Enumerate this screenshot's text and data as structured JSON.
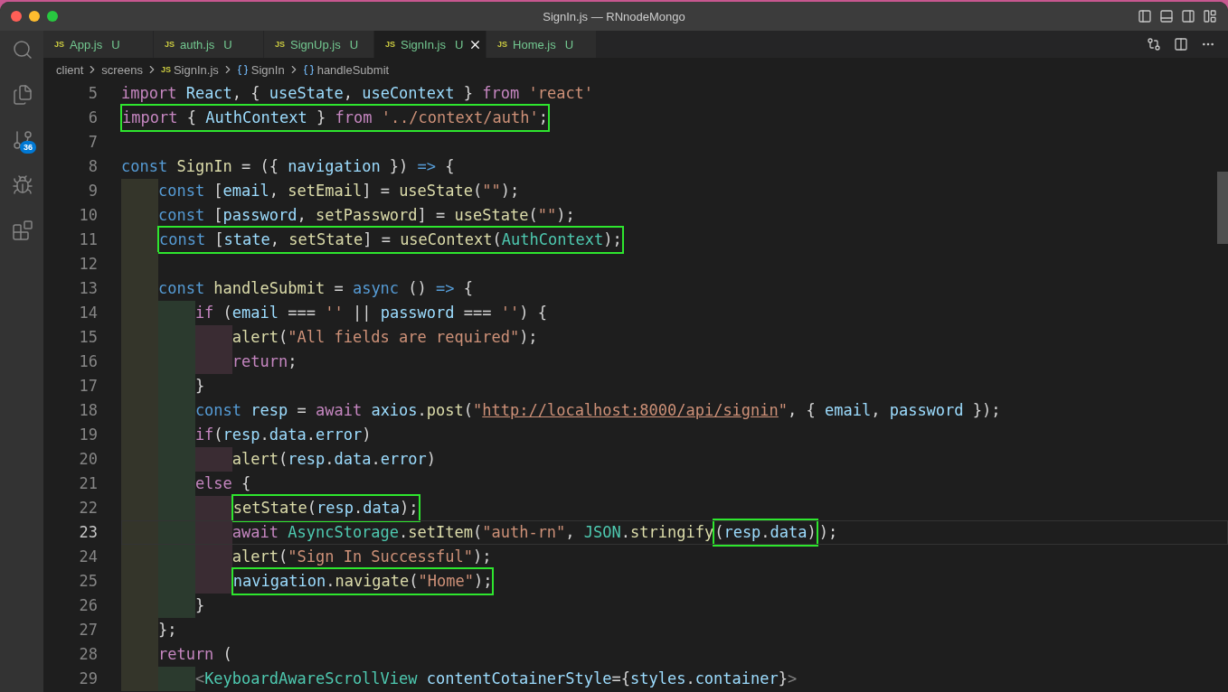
{
  "window": {
    "title": "SignIn.js — RNnodeMongo"
  },
  "activity_bar": [
    {
      "kind": "search",
      "selected": false
    },
    {
      "kind": "explorer",
      "selected": false
    },
    {
      "kind": "source-control",
      "selected": false,
      "badge": "36"
    },
    {
      "kind": "debug",
      "selected": false
    },
    {
      "kind": "extensions",
      "selected": false
    }
  ],
  "tabs": [
    {
      "icon_text": "JS",
      "label": "App.js",
      "status": "U",
      "selected": false
    },
    {
      "icon_text": "JS",
      "label": "auth.js",
      "status": "U",
      "selected": false
    },
    {
      "icon_text": "JS",
      "label": "SignUp.js",
      "status": "U",
      "selected": false
    },
    {
      "icon_text": "JS",
      "label": "SignIn.js",
      "status": "U",
      "selected": true
    },
    {
      "icon_text": "JS",
      "label": "Home.js",
      "status": "U",
      "selected": false
    }
  ],
  "breadcrumb": [
    {
      "kind": "folder",
      "label": "client"
    },
    {
      "kind": "folder",
      "label": "screens"
    },
    {
      "kind": "file",
      "icon_text": "JS",
      "label": "SignIn.js"
    },
    {
      "kind": "symbol",
      "label": "SignIn"
    },
    {
      "kind": "symbol",
      "label": "handleSubmit"
    }
  ],
  "editor": {
    "lines": [
      {
        "number": "5",
        "current": false,
        "parts": [
          {
            "kind": "kw",
            "text": "import "
          },
          {
            "kind": "var",
            "text": "React"
          },
          {
            "kind": "p",
            "text": ", { "
          },
          {
            "kind": "var",
            "text": "useState"
          },
          {
            "kind": "p",
            "text": ", "
          },
          {
            "kind": "var",
            "text": "useContext"
          },
          {
            "kind": "p",
            "text": " } "
          },
          {
            "kind": "kw",
            "text": "from "
          },
          {
            "kind": "str",
            "text": "'react'"
          }
        ]
      },
      {
        "number": "6",
        "current": false,
        "parts": [
          {
            "kind": "box",
            "parts": [
              {
                "kind": "kw",
                "text": "import "
              },
              {
                "kind": "p",
                "text": "{ "
              },
              {
                "kind": "var",
                "text": "AuthContext"
              },
              {
                "kind": "p",
                "text": " } "
              },
              {
                "kind": "kw",
                "text": "from "
              },
              {
                "kind": "str",
                "text": "'../context/auth'"
              },
              {
                "kind": "p",
                "text": ";"
              }
            ]
          }
        ]
      },
      {
        "number": "7",
        "current": false
      },
      {
        "number": "8",
        "current": false,
        "parts": [
          {
            "kind": "st",
            "text": "const "
          },
          {
            "kind": "fn",
            "text": "SignIn"
          },
          {
            "kind": "p",
            "text": " = ({ "
          },
          {
            "kind": "var",
            "text": "navigation"
          },
          {
            "kind": "p",
            "text": " }) "
          },
          {
            "kind": "st",
            "text": "=>"
          },
          {
            "kind": "p",
            "text": " {"
          }
        ]
      },
      {
        "number": "9",
        "current": false,
        "guides": [
          {
            "color": "#34352a"
          }
        ],
        "parts": [
          {
            "kind": "st",
            "text": "const "
          },
          {
            "kind": "p",
            "text": "["
          },
          {
            "kind": "var",
            "text": "email"
          },
          {
            "kind": "p",
            "text": ", "
          },
          {
            "kind": "fn",
            "text": "setEmail"
          },
          {
            "kind": "p",
            "text": "] = "
          },
          {
            "kind": "fn",
            "text": "useState"
          },
          {
            "kind": "p",
            "text": "("
          },
          {
            "kind": "str",
            "text": "\"\""
          },
          {
            "kind": "p",
            "text": ");"
          }
        ]
      },
      {
        "number": "10",
        "current": false,
        "guides": [
          {
            "color": "#34352a"
          }
        ],
        "parts": [
          {
            "kind": "st",
            "text": "const "
          },
          {
            "kind": "p",
            "text": "["
          },
          {
            "kind": "var",
            "text": "password"
          },
          {
            "kind": "p",
            "text": ", "
          },
          {
            "kind": "fn",
            "text": "setPassword"
          },
          {
            "kind": "p",
            "text": "] = "
          },
          {
            "kind": "fn",
            "text": "useState"
          },
          {
            "kind": "p",
            "text": "("
          },
          {
            "kind": "str",
            "text": "\"\""
          },
          {
            "kind": "p",
            "text": ");"
          }
        ]
      },
      {
        "number": "11",
        "current": false,
        "guides": [
          {
            "color": "#34352a"
          }
        ],
        "parts": [
          {
            "kind": "box",
            "parts": [
              {
                "kind": "st",
                "text": "const "
              },
              {
                "kind": "p",
                "text": "["
              },
              {
                "kind": "var",
                "text": "state"
              },
              {
                "kind": "p",
                "text": ", "
              },
              {
                "kind": "fn",
                "text": "setState"
              },
              {
                "kind": "p",
                "text": "] = "
              },
              {
                "kind": "fn",
                "text": "useContext"
              },
              {
                "kind": "p",
                "text": "("
              },
              {
                "kind": "cls",
                "text": "AuthContext"
              },
              {
                "kind": "p",
                "text": ");"
              }
            ]
          }
        ]
      },
      {
        "number": "12",
        "current": false,
        "guides": [
          {
            "color": "#34352a"
          }
        ]
      },
      {
        "number": "13",
        "current": false,
        "guides": [
          {
            "color": "#34352a"
          }
        ],
        "parts": [
          {
            "kind": "st",
            "text": "const "
          },
          {
            "kind": "fn",
            "text": "handleSubmit"
          },
          {
            "kind": "p",
            "text": " = "
          },
          {
            "kind": "st",
            "text": "async"
          },
          {
            "kind": "p",
            "text": " () "
          },
          {
            "kind": "st",
            "text": "=>"
          },
          {
            "kind": "p",
            "text": " {"
          }
        ]
      },
      {
        "number": "14",
        "current": false,
        "guides": [
          {
            "color": "#34352a"
          },
          {
            "color": "#2b3a2e"
          }
        ],
        "parts": [
          {
            "kind": "kw",
            "text": "if"
          },
          {
            "kind": "p",
            "text": " ("
          },
          {
            "kind": "var",
            "text": "email"
          },
          {
            "kind": "p",
            "text": " === "
          },
          {
            "kind": "str",
            "text": "''"
          },
          {
            "kind": "p",
            "text": " || "
          },
          {
            "kind": "var",
            "text": "password"
          },
          {
            "kind": "p",
            "text": " === "
          },
          {
            "kind": "str",
            "text": "''"
          },
          {
            "kind": "p",
            "text": ") {"
          }
        ]
      },
      {
        "number": "15",
        "current": false,
        "guides": [
          {
            "color": "#34352a"
          },
          {
            "color": "#2b3a2e"
          },
          {
            "color": "#3a2c33"
          }
        ],
        "parts": [
          {
            "kind": "fn",
            "text": "alert"
          },
          {
            "kind": "p",
            "text": "("
          },
          {
            "kind": "str",
            "text": "\"All fields are required\""
          },
          {
            "kind": "p",
            "text": ");"
          }
        ]
      },
      {
        "number": "16",
        "current": false,
        "guides": [
          {
            "color": "#34352a"
          },
          {
            "color": "#2b3a2e"
          },
          {
            "color": "#3a2c33"
          }
        ],
        "parts": [
          {
            "kind": "kw",
            "text": "return"
          },
          {
            "kind": "p",
            "text": ";"
          }
        ]
      },
      {
        "number": "17",
        "current": false,
        "guides": [
          {
            "color": "#34352a"
          },
          {
            "color": "#2b3a2e"
          }
        ],
        "parts": [
          {
            "kind": "p",
            "text": "}"
          }
        ]
      },
      {
        "number": "18",
        "current": false,
        "guides": [
          {
            "color": "#34352a"
          },
          {
            "color": "#2b3a2e"
          }
        ],
        "parts": [
          {
            "kind": "st",
            "text": "const "
          },
          {
            "kind": "var",
            "text": "resp"
          },
          {
            "kind": "p",
            "text": " = "
          },
          {
            "kind": "kw",
            "text": "await "
          },
          {
            "kind": "var",
            "text": "axios"
          },
          {
            "kind": "p",
            "text": "."
          },
          {
            "kind": "fn",
            "text": "post"
          },
          {
            "kind": "p",
            "text": "("
          },
          {
            "kind": "str",
            "text": "\""
          },
          {
            "kind": "link",
            "text": "http://localhost:8000/api/signin"
          },
          {
            "kind": "str",
            "text": "\""
          },
          {
            "kind": "p",
            "text": ", { "
          },
          {
            "kind": "var",
            "text": "email"
          },
          {
            "kind": "p",
            "text": ", "
          },
          {
            "kind": "var",
            "text": "password"
          },
          {
            "kind": "p",
            "text": " });"
          }
        ]
      },
      {
        "number": "19",
        "current": false,
        "guides": [
          {
            "color": "#34352a"
          },
          {
            "color": "#2b3a2e"
          }
        ],
        "parts": [
          {
            "kind": "kw",
            "text": "if"
          },
          {
            "kind": "p",
            "text": "("
          },
          {
            "kind": "var",
            "text": "resp"
          },
          {
            "kind": "p",
            "text": "."
          },
          {
            "kind": "var",
            "text": "data"
          },
          {
            "kind": "p",
            "text": "."
          },
          {
            "kind": "var",
            "text": "error"
          },
          {
            "kind": "p",
            "text": ")"
          }
        ]
      },
      {
        "number": "20",
        "current": false,
        "guides": [
          {
            "color": "#34352a"
          },
          {
            "color": "#2b3a2e"
          },
          {
            "color": "#3a2c33"
          }
        ],
        "parts": [
          {
            "kind": "fn",
            "text": "alert"
          },
          {
            "kind": "p",
            "text": "("
          },
          {
            "kind": "var",
            "text": "resp"
          },
          {
            "kind": "p",
            "text": "."
          },
          {
            "kind": "var",
            "text": "data"
          },
          {
            "kind": "p",
            "text": "."
          },
          {
            "kind": "var",
            "text": "error"
          },
          {
            "kind": "p",
            "text": ")"
          }
        ]
      },
      {
        "number": "21",
        "current": false,
        "guides": [
          {
            "color": "#34352a"
          },
          {
            "color": "#2b3a2e"
          }
        ],
        "parts": [
          {
            "kind": "kw",
            "text": "else"
          },
          {
            "kind": "p",
            "text": " {"
          }
        ]
      },
      {
        "number": "22",
        "current": false,
        "guides": [
          {
            "color": "#34352a"
          },
          {
            "color": "#2b3a2e"
          },
          {
            "color": "#3a2c33"
          }
        ],
        "parts": [
          {
            "kind": "box",
            "parts": [
              {
                "kind": "fn",
                "text": "setState"
              },
              {
                "kind": "p",
                "text": "("
              },
              {
                "kind": "var",
                "text": "resp"
              },
              {
                "kind": "p",
                "text": "."
              },
              {
                "kind": "var",
                "text": "data"
              },
              {
                "kind": "p",
                "text": ");"
              }
            ]
          }
        ]
      },
      {
        "number": "23",
        "current": true,
        "guides": [
          {
            "color": "#34352a"
          },
          {
            "color": "#2b3a2e"
          },
          {
            "color": "#3a2c33"
          }
        ],
        "parts": [
          {
            "kind": "kw",
            "text": "await "
          },
          {
            "kind": "cls",
            "text": "AsyncStorage"
          },
          {
            "kind": "p",
            "text": "."
          },
          {
            "kind": "fn",
            "text": "setItem"
          },
          {
            "kind": "p",
            "text": "("
          },
          {
            "kind": "str",
            "text": "\"auth-rn\""
          },
          {
            "kind": "p",
            "text": ", "
          },
          {
            "kind": "cls",
            "text": "JSON"
          },
          {
            "kind": "p",
            "text": "."
          },
          {
            "kind": "fn",
            "text": "stringify"
          },
          {
            "kind": "box",
            "parts": [
              {
                "kind": "p",
                "text": "("
              },
              {
                "kind": "var",
                "text": "resp"
              },
              {
                "kind": "p",
                "text": "."
              },
              {
                "kind": "var",
                "text": "data"
              },
              {
                "kind": "p",
                "text": ")"
              }
            ]
          },
          {
            "kind": "p",
            "text": ");"
          }
        ]
      },
      {
        "number": "24",
        "current": false,
        "guides": [
          {
            "color": "#34352a"
          },
          {
            "color": "#2b3a2e"
          },
          {
            "color": "#3a2c33"
          }
        ],
        "parts": [
          {
            "kind": "fn",
            "text": "alert"
          },
          {
            "kind": "p",
            "text": "("
          },
          {
            "kind": "str",
            "text": "\"Sign In Successful\""
          },
          {
            "kind": "p",
            "text": ");"
          }
        ]
      },
      {
        "number": "25",
        "current": false,
        "guides": [
          {
            "color": "#34352a"
          },
          {
            "color": "#2b3a2e"
          },
          {
            "color": "#3a2c33"
          }
        ],
        "parts": [
          {
            "kind": "box",
            "parts": [
              {
                "kind": "var",
                "text": "navigation"
              },
              {
                "kind": "p",
                "text": "."
              },
              {
                "kind": "fn",
                "text": "navigate"
              },
              {
                "kind": "p",
                "text": "("
              },
              {
                "kind": "str",
                "text": "\"Home\""
              },
              {
                "kind": "p",
                "text": ");"
              }
            ]
          }
        ]
      },
      {
        "number": "26",
        "current": false,
        "guides": [
          {
            "color": "#34352a"
          },
          {
            "color": "#2b3a2e"
          }
        ],
        "parts": [
          {
            "kind": "p",
            "text": "}"
          }
        ]
      },
      {
        "number": "27",
        "current": false,
        "guides": [
          {
            "color": "#34352a"
          }
        ],
        "parts": [
          {
            "kind": "p",
            "text": "};"
          }
        ]
      },
      {
        "number": "28",
        "current": false,
        "guides": [
          {
            "color": "#34352a"
          }
        ],
        "parts": [
          {
            "kind": "kw",
            "text": "return"
          },
          {
            "kind": "p",
            "text": " ("
          }
        ]
      },
      {
        "number": "29",
        "current": false,
        "guides": [
          {
            "color": "#34352a"
          },
          {
            "color": "#2b3a2e"
          }
        ],
        "parts": [
          {
            "kind": "tag",
            "text": "<"
          },
          {
            "kind": "cls",
            "text": "KeyboardAwareScrollView "
          },
          {
            "kind": "var",
            "text": "contentCotainerStyle"
          },
          {
            "kind": "p",
            "text": "={"
          },
          {
            "kind": "var",
            "text": "styles"
          },
          {
            "kind": "p",
            "text": "."
          },
          {
            "kind": "var",
            "text": "container"
          },
          {
            "kind": "p",
            "text": "}"
          },
          {
            "kind": "tag",
            "text": ">"
          }
        ]
      }
    ]
  }
}
